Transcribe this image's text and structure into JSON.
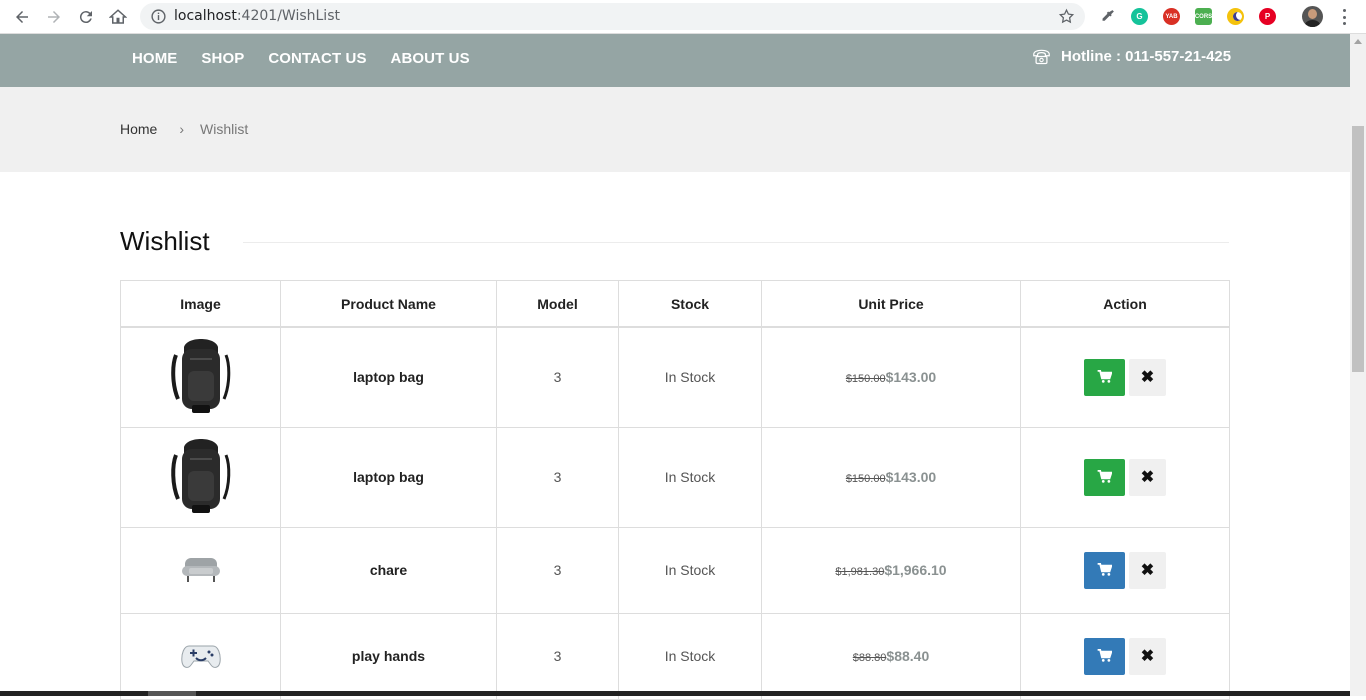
{
  "browser": {
    "url_host": "localhost",
    "url_path": ":4201/WishList",
    "extensions": [
      {
        "name": "eyedropper-icon",
        "color": "#5f6368",
        "label": ""
      },
      {
        "name": "grammarly-icon",
        "color": "#15c39a",
        "label": "G"
      },
      {
        "name": "yab-icon",
        "color": "#d93025",
        "label": "YAB"
      },
      {
        "name": "cors-icon",
        "color": "#4caf50",
        "label": "CORS"
      },
      {
        "name": "moon-icon",
        "color": "#f4c20d",
        "label": ""
      },
      {
        "name": "pinterest-icon",
        "color": "#e60023",
        "label": "P"
      }
    ]
  },
  "nav": {
    "items": [
      "HOME",
      "SHOP",
      "CONTACT US",
      "ABOUT US"
    ],
    "hotline_label": "Hotline :",
    "hotline_number": "011-557-21-425",
    "bg_color": "#95a5a4"
  },
  "breadcrumb": {
    "home": "Home",
    "separator": "›",
    "current": "Wishlist"
  },
  "page": {
    "title": "Wishlist"
  },
  "table": {
    "headers": [
      "Image",
      "Product Name",
      "Model",
      "Stock",
      "Unit Price",
      "Action"
    ],
    "rows": [
      {
        "image": "backpack",
        "name": "laptop bag",
        "model": "3",
        "stock": "In Stock",
        "old_price": "$150.00",
        "price": "$143.00",
        "cart_color": "green"
      },
      {
        "image": "backpack",
        "name": "laptop bag",
        "model": "3",
        "stock": "In Stock",
        "old_price": "$150.00",
        "price": "$143.00",
        "cart_color": "green"
      },
      {
        "image": "sofa",
        "name": "chare",
        "model": "3",
        "stock": "In Stock",
        "old_price": "$1,981.30",
        "price": "$1,966.10",
        "cart_color": "blue"
      },
      {
        "image": "gamepad",
        "name": "play hands",
        "model": "3",
        "stock": "In Stock",
        "old_price": "$88.80",
        "price": "$88.40",
        "cart_color": "blue"
      }
    ],
    "remove_symbol": "✖"
  },
  "colors": {
    "green": "#28a745",
    "blue": "#337ab7"
  }
}
